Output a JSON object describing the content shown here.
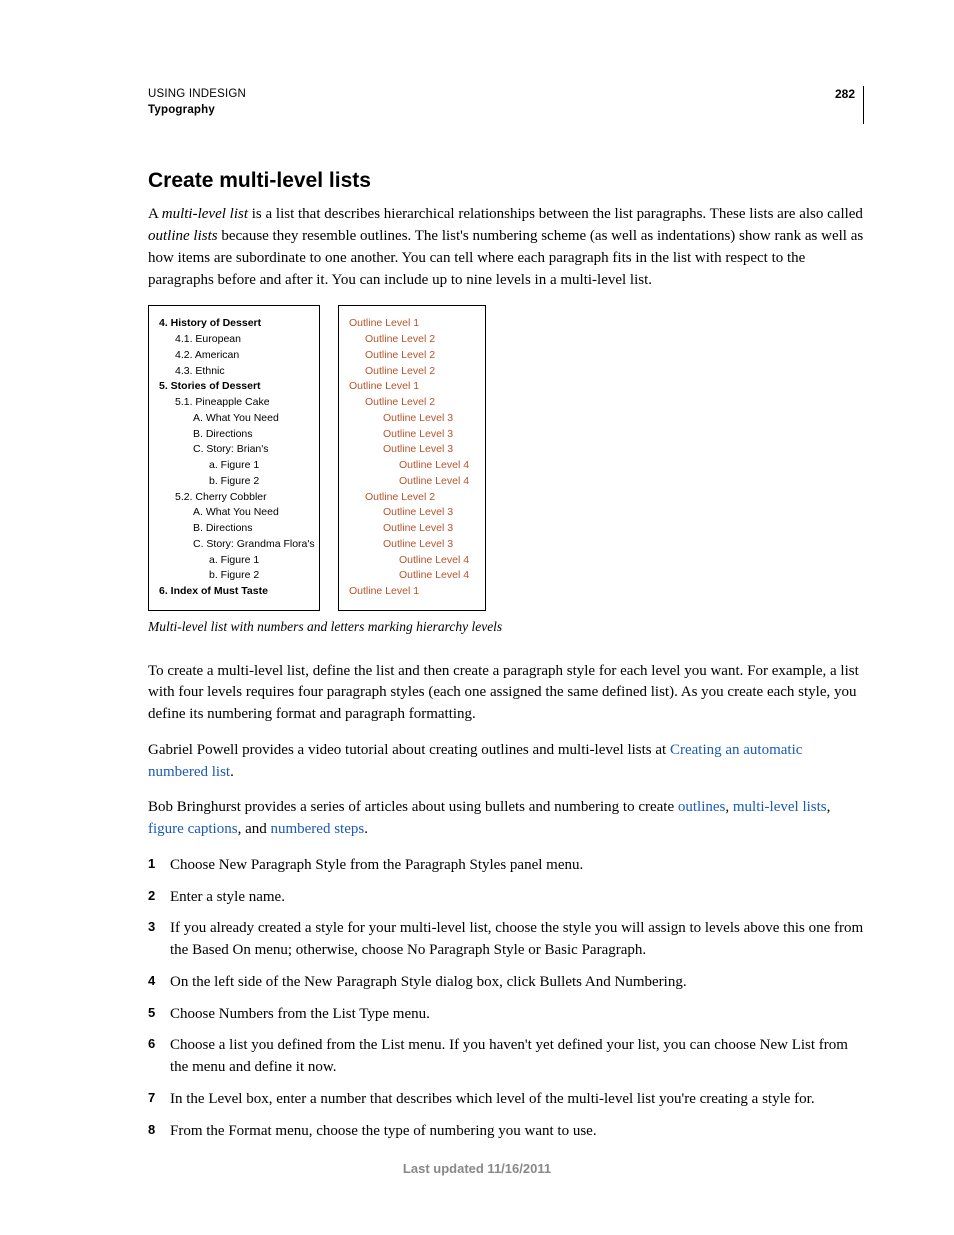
{
  "header": {
    "book": "USING INDESIGN",
    "chapter": "Typography",
    "page": "282"
  },
  "section_title": "Create multi-level lists",
  "intro": {
    "prefix": "A ",
    "term1": "multi-level list",
    "mid1": " is a list that describes hierarchical relationships between the list paragraphs. These lists are also called ",
    "term2": "outline lists",
    "rest": " because they resemble outlines. The list's numbering scheme (as well as indentations) show rank as well as how items are subordinate to one another. You can tell where each paragraph fits in the list with respect to the paragraphs before and after it. You can include up to nine levels in a multi-level list."
  },
  "figure": {
    "left": [
      {
        "t": "4.  History of Dessert",
        "l": 0
      },
      {
        "t": "4.1.  European",
        "l": 1
      },
      {
        "t": "4.2.  American",
        "l": 1
      },
      {
        "t": "4.3.  Ethnic",
        "l": 1
      },
      {
        "t": "5.  Stories of Dessert",
        "l": 0
      },
      {
        "t": "5.1.  Pineapple Cake",
        "l": 1
      },
      {
        "t": "A.  What You Need",
        "l": 2
      },
      {
        "t": "B.  Directions",
        "l": 2
      },
      {
        "t": "C.  Story: Brian's",
        "l": 2
      },
      {
        "t": "a.  Figure 1",
        "l": 3
      },
      {
        "t": "b.  Figure 2",
        "l": 3
      },
      {
        "t": "5.2.  Cherry Cobbler",
        "l": 1
      },
      {
        "t": "A.  What You Need",
        "l": 2
      },
      {
        "t": "B.  Directions",
        "l": 2
      },
      {
        "t": "C.  Story: Grandma Flora's",
        "l": 2
      },
      {
        "t": "a.  Figure 1",
        "l": 3
      },
      {
        "t": "b.  Figure 2",
        "l": 3
      },
      {
        "t": "6.  Index of Must Taste",
        "l": 0
      }
    ],
    "right": [
      {
        "t": "Outline Level 1",
        "l": 0
      },
      {
        "t": "Outline Level 2",
        "l": 1
      },
      {
        "t": "Outline Level 2",
        "l": 1
      },
      {
        "t": "Outline Level 2",
        "l": 1
      },
      {
        "t": "Outline Level 1",
        "l": 0
      },
      {
        "t": "Outline Level 2",
        "l": 1
      },
      {
        "t": "Outline Level 3",
        "l": 2
      },
      {
        "t": "Outline Level 3",
        "l": 2
      },
      {
        "t": "Outline Level 3",
        "l": 2
      },
      {
        "t": "Outline Level 4",
        "l": 3
      },
      {
        "t": "Outline Level 4",
        "l": 3
      },
      {
        "t": "Outline Level 2",
        "l": 1
      },
      {
        "t": "Outline Level 3",
        "l": 2
      },
      {
        "t": "Outline Level 3",
        "l": 2
      },
      {
        "t": "Outline Level 3",
        "l": 2
      },
      {
        "t": "Outline Level 4",
        "l": 3
      },
      {
        "t": "Outline Level 4",
        "l": 3
      },
      {
        "t": "Outline Level 1",
        "l": 0
      }
    ],
    "caption": "Multi-level list with numbers and letters marking hierarchy levels"
  },
  "para2": "To create a multi-level list, define the list and then create a paragraph style for each level you want. For example, a list with four levels requires four paragraph styles (each one assigned the same defined list). As you create each style, you define its numbering format and paragraph formatting.",
  "para3": {
    "pre": "Gabriel Powell provides a video tutorial about creating outlines and multi-level lists at ",
    "link": "Creating an automatic numbered list",
    "post": "."
  },
  "para4": {
    "pre": "Bob Bringhurst provides a series of articles about using bullets and numbering to create ",
    "l1": "outlines",
    "c1": ", ",
    "l2": "multi-level lists",
    "c2": ", ",
    "l3": "figure captions",
    "c3": ", and ",
    "l4": "numbered steps",
    "post": "."
  },
  "steps": [
    "Choose New Paragraph Style from the Paragraph Styles panel menu.",
    "Enter a style name.",
    "If you already created a style for your multi-level list, choose the style you will assign to levels above this one from the Based On menu; otherwise, choose No Paragraph Style or Basic Paragraph.",
    "On the left side of the New Paragraph Style dialog box, click Bullets And Numbering.",
    "Choose Numbers from the List Type menu.",
    "Choose a list you defined from the List menu. If you haven't yet defined your list, you can choose New List from the menu and define it now.",
    "In the Level box, enter a number that describes which level of the multi-level list you're creating a style for.",
    "From the Format menu, choose the type of numbering you want to use."
  ],
  "footer": "Last updated 11/16/2011"
}
